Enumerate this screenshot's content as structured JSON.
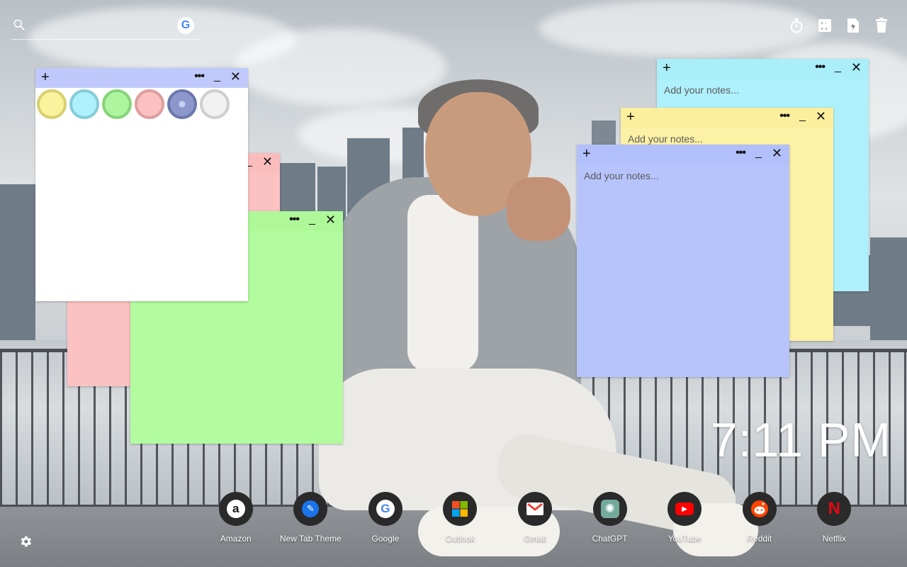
{
  "search": {
    "placeholder": "",
    "engine_icon": "google-icon",
    "engine_letter": "G"
  },
  "top_toolbar": [
    {
      "icon": "timer-icon"
    },
    {
      "icon": "calculator-icon"
    },
    {
      "icon": "document-icon"
    },
    {
      "icon": "trash-icon"
    }
  ],
  "notes": [
    {
      "id": "cyan",
      "color": "#aef0fb",
      "header_color": "#a9eef9",
      "placeholder": "Add your notes...",
      "plus": "+",
      "dots": "•••",
      "min": "_",
      "close": "✕"
    },
    {
      "id": "yellow",
      "color": "#fcf1a4",
      "header_color": "#fbef9e",
      "placeholder": "Add your notes...",
      "plus": "+",
      "dots": "•••",
      "min": "_",
      "close": "✕"
    },
    {
      "id": "blue",
      "color": "#b6c4fb",
      "header_color": "#b1bffa",
      "placeholder": "Add your notes...",
      "plus": "+",
      "dots": "•••",
      "min": "_",
      "close": "✕"
    },
    {
      "id": "pink",
      "color": "#fcc2c2",
      "dots": "•••",
      "min": "_",
      "close": "✕"
    },
    {
      "id": "green",
      "color": "#b3fb9f",
      "dots": "•••",
      "min": "_",
      "close": "✕"
    },
    {
      "id": "white",
      "color": "#ffffff",
      "header_color": "#bfc9fb",
      "plus": "+",
      "dots": "•••",
      "min": "_",
      "close": "✕"
    }
  ],
  "color_swatches": [
    {
      "name": "yellow",
      "fill": "#fbf29e",
      "border": "#d8d070"
    },
    {
      "name": "cyan",
      "fill": "#aef0fb",
      "border": "#86ccd8"
    },
    {
      "name": "green",
      "fill": "#aef5a0",
      "border": "#86d47a"
    },
    {
      "name": "pink",
      "fill": "#fcc0c0",
      "border": "#dc9e9e"
    },
    {
      "name": "blue",
      "fill": "#8c98cc",
      "border": "#6c78ac",
      "selected": true
    },
    {
      "name": "white",
      "fill": "#f2f2f2",
      "border": "#cfcfcf"
    }
  ],
  "clock": {
    "time": "7:11 PM"
  },
  "dock": [
    {
      "label": "Amazon",
      "icon": "amazon-icon",
      "glyph": "a"
    },
    {
      "label": "New Tab Theme",
      "icon": "new-tab-theme-icon",
      "glyph": "✎"
    },
    {
      "label": "Google",
      "icon": "google-icon",
      "glyph": "G"
    },
    {
      "label": "Outlook",
      "icon": "outlook-icon",
      "glyph": ""
    },
    {
      "label": "Gmail",
      "icon": "gmail-icon",
      "glyph": "M"
    },
    {
      "label": "ChatGPT",
      "icon": "chatgpt-icon",
      "glyph": "✺"
    },
    {
      "label": "YouTube",
      "icon": "youtube-icon",
      "glyph": "▶"
    },
    {
      "label": "Reddit",
      "icon": "reddit-icon",
      "glyph": ""
    },
    {
      "label": "Netflix",
      "icon": "netflix-icon",
      "glyph": "N"
    }
  ],
  "settings": {
    "icon": "gear-icon"
  }
}
